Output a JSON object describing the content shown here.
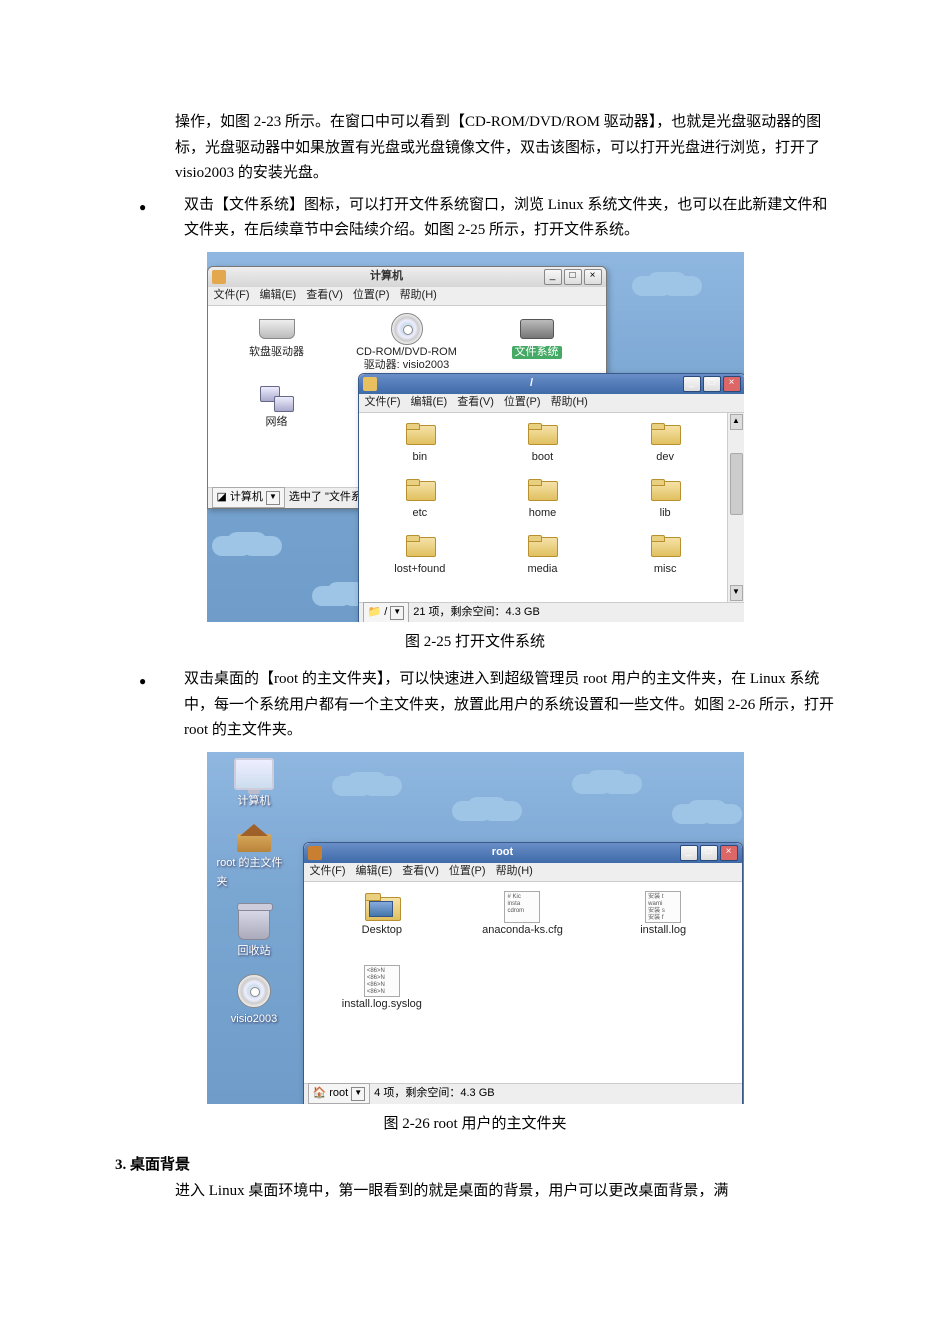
{
  "para1": "操作，如图 2-23 所示。在窗口中可以看到【CD-ROM/DVD/ROM 驱动器】，也就是光盘驱动器的图标，光盘驱动器中如果放置有光盘或光盘镜像文件，双击该图标，可以打开光盘进行浏览，打开了 visio2003 的安装光盘。",
  "bullet1": "双击【文件系统】图标，可以打开文件系统窗口，浏览 Linux 系统文件夹，也可以在此新建文件和文件夹，在后续章节中会陆续介绍。如图 2-25 所示，打开文件系统。",
  "cap1": "图 2-25 打开文件系统",
  "bullet2": "双击桌面的【root 的主文件夹】，可以快速进入到超级管理员 root 用户的主文件夹，在 Linux 系统中，每一个系统用户都有一个主文件夹，放置此用户的系统设置和一些文件。如图 2-26 所示，打开 root 的主文件夹。",
  "cap2": "图 2-26 root 用户的主文件夹",
  "heading3": "3. 桌面背景",
  "para3": "进入 Linux 桌面环境中，第一眼看到的就是桌面的背景，用户可以更改桌面背景，满",
  "menus": {
    "file": "文件(F)",
    "edit": "编辑(E)",
    "view": "查看(V)",
    "places": "位置(P)",
    "help": "帮助(H)"
  },
  "win1": {
    "title": "计算机",
    "items": {
      "floppy": "软盘驱动器",
      "cdrom_l1": "CD-ROM/DVD-ROM",
      "cdrom_l2": "驱动器: visio2003",
      "fs": "文件系统",
      "net": "网络"
    },
    "status_chip": "计算机",
    "status_text": "选中了 \"文件系统\""
  },
  "win2": {
    "title": "/",
    "folders": [
      "bin",
      "boot",
      "dev",
      "etc",
      "home",
      "lib",
      "lost+found",
      "media",
      "misc"
    ],
    "status_path": "/",
    "status_text": "21 项，剩余空间：4.3 GB"
  },
  "desktop": {
    "computer": "计算机",
    "root_home": "root 的主文件夹",
    "trash": "回收站",
    "visio": "visio2003"
  },
  "win3": {
    "title": "root",
    "items": {
      "desktop": "Desktop",
      "anaconda": "anaconda-ks.cfg",
      "anaconda_preview": "# Kic\ninsta\ncdrom",
      "install_log": "install.log",
      "install_log_preview": "安装 t\nwarni\n安装 s\n安装 f",
      "syslog": "install.log.syslog",
      "syslog_preview": "<86>N\n<86>N\n<86>N\n<86>N"
    },
    "status_chip": "root",
    "status_text": "4 项，剩余空间：4.3 GB"
  }
}
